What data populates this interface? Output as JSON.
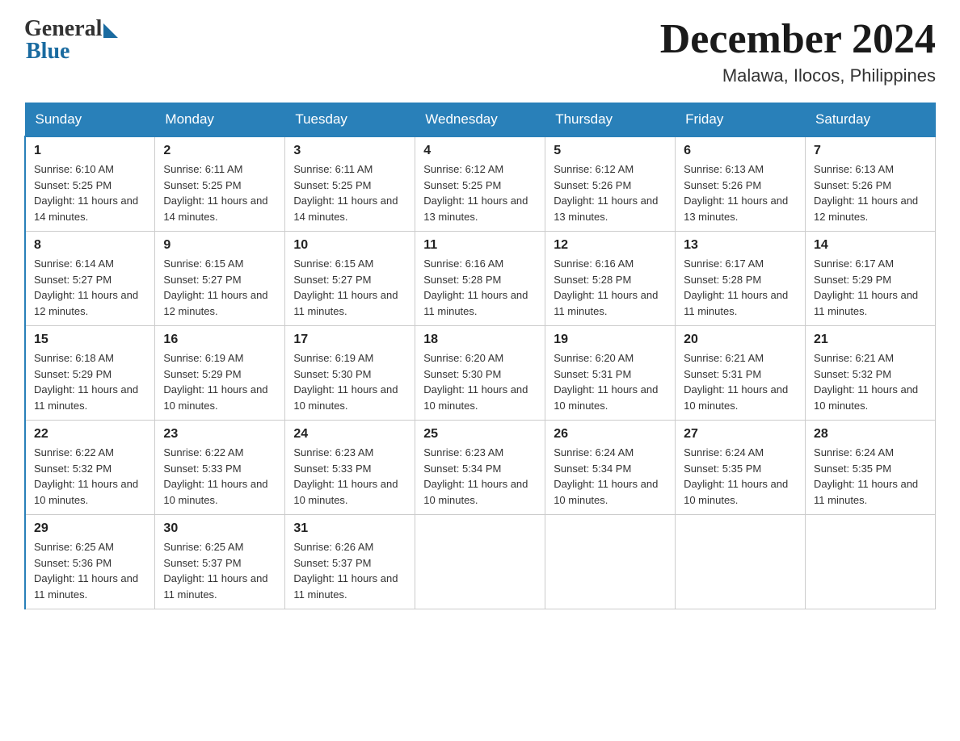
{
  "logo": {
    "general": "General",
    "blue": "Blue"
  },
  "title": "December 2024",
  "location": "Malawa, Ilocos, Philippines",
  "weekdays": [
    "Sunday",
    "Monday",
    "Tuesday",
    "Wednesday",
    "Thursday",
    "Friday",
    "Saturday"
  ],
  "weeks": [
    [
      {
        "day": 1,
        "sunrise": "6:10 AM",
        "sunset": "5:25 PM",
        "daylight": "11 hours and 14 minutes."
      },
      {
        "day": 2,
        "sunrise": "6:11 AM",
        "sunset": "5:25 PM",
        "daylight": "11 hours and 14 minutes."
      },
      {
        "day": 3,
        "sunrise": "6:11 AM",
        "sunset": "5:25 PM",
        "daylight": "11 hours and 14 minutes."
      },
      {
        "day": 4,
        "sunrise": "6:12 AM",
        "sunset": "5:25 PM",
        "daylight": "11 hours and 13 minutes."
      },
      {
        "day": 5,
        "sunrise": "6:12 AM",
        "sunset": "5:26 PM",
        "daylight": "11 hours and 13 minutes."
      },
      {
        "day": 6,
        "sunrise": "6:13 AM",
        "sunset": "5:26 PM",
        "daylight": "11 hours and 13 minutes."
      },
      {
        "day": 7,
        "sunrise": "6:13 AM",
        "sunset": "5:26 PM",
        "daylight": "11 hours and 12 minutes."
      }
    ],
    [
      {
        "day": 8,
        "sunrise": "6:14 AM",
        "sunset": "5:27 PM",
        "daylight": "11 hours and 12 minutes."
      },
      {
        "day": 9,
        "sunrise": "6:15 AM",
        "sunset": "5:27 PM",
        "daylight": "11 hours and 12 minutes."
      },
      {
        "day": 10,
        "sunrise": "6:15 AM",
        "sunset": "5:27 PM",
        "daylight": "11 hours and 11 minutes."
      },
      {
        "day": 11,
        "sunrise": "6:16 AM",
        "sunset": "5:28 PM",
        "daylight": "11 hours and 11 minutes."
      },
      {
        "day": 12,
        "sunrise": "6:16 AM",
        "sunset": "5:28 PM",
        "daylight": "11 hours and 11 minutes."
      },
      {
        "day": 13,
        "sunrise": "6:17 AM",
        "sunset": "5:28 PM",
        "daylight": "11 hours and 11 minutes."
      },
      {
        "day": 14,
        "sunrise": "6:17 AM",
        "sunset": "5:29 PM",
        "daylight": "11 hours and 11 minutes."
      }
    ],
    [
      {
        "day": 15,
        "sunrise": "6:18 AM",
        "sunset": "5:29 PM",
        "daylight": "11 hours and 11 minutes."
      },
      {
        "day": 16,
        "sunrise": "6:19 AM",
        "sunset": "5:29 PM",
        "daylight": "11 hours and 10 minutes."
      },
      {
        "day": 17,
        "sunrise": "6:19 AM",
        "sunset": "5:30 PM",
        "daylight": "11 hours and 10 minutes."
      },
      {
        "day": 18,
        "sunrise": "6:20 AM",
        "sunset": "5:30 PM",
        "daylight": "11 hours and 10 minutes."
      },
      {
        "day": 19,
        "sunrise": "6:20 AM",
        "sunset": "5:31 PM",
        "daylight": "11 hours and 10 minutes."
      },
      {
        "day": 20,
        "sunrise": "6:21 AM",
        "sunset": "5:31 PM",
        "daylight": "11 hours and 10 minutes."
      },
      {
        "day": 21,
        "sunrise": "6:21 AM",
        "sunset": "5:32 PM",
        "daylight": "11 hours and 10 minutes."
      }
    ],
    [
      {
        "day": 22,
        "sunrise": "6:22 AM",
        "sunset": "5:32 PM",
        "daylight": "11 hours and 10 minutes."
      },
      {
        "day": 23,
        "sunrise": "6:22 AM",
        "sunset": "5:33 PM",
        "daylight": "11 hours and 10 minutes."
      },
      {
        "day": 24,
        "sunrise": "6:23 AM",
        "sunset": "5:33 PM",
        "daylight": "11 hours and 10 minutes."
      },
      {
        "day": 25,
        "sunrise": "6:23 AM",
        "sunset": "5:34 PM",
        "daylight": "11 hours and 10 minutes."
      },
      {
        "day": 26,
        "sunrise": "6:24 AM",
        "sunset": "5:34 PM",
        "daylight": "11 hours and 10 minutes."
      },
      {
        "day": 27,
        "sunrise": "6:24 AM",
        "sunset": "5:35 PM",
        "daylight": "11 hours and 10 minutes."
      },
      {
        "day": 28,
        "sunrise": "6:24 AM",
        "sunset": "5:35 PM",
        "daylight": "11 hours and 11 minutes."
      }
    ],
    [
      {
        "day": 29,
        "sunrise": "6:25 AM",
        "sunset": "5:36 PM",
        "daylight": "11 hours and 11 minutes."
      },
      {
        "day": 30,
        "sunrise": "6:25 AM",
        "sunset": "5:37 PM",
        "daylight": "11 hours and 11 minutes."
      },
      {
        "day": 31,
        "sunrise": "6:26 AM",
        "sunset": "5:37 PM",
        "daylight": "11 hours and 11 minutes."
      },
      null,
      null,
      null,
      null
    ]
  ]
}
